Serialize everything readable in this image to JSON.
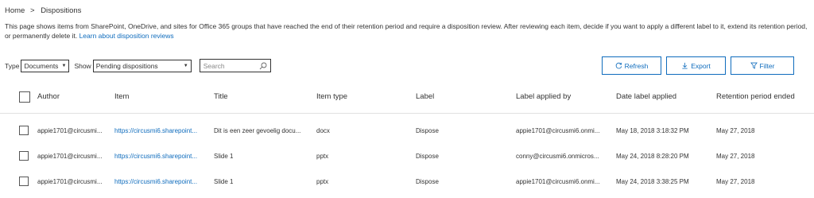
{
  "breadcrumb": {
    "home": "Home",
    "separator": ">",
    "current": "Dispositions"
  },
  "intro": {
    "text": "This page shows items from SharePoint, OneDrive, and sites for Office 365 groups that have reached the end of their retention period and require a disposition review. After reviewing each item, decide if you want to apply a different label to it, extend its retention period, or permanently delete it.",
    "link": "Learn about disposition reviews"
  },
  "filters": {
    "type_label": "Type",
    "type_value": "Documents",
    "show_label": "Show",
    "show_value": "Pending dispositions",
    "search_placeholder": "Search"
  },
  "actions": {
    "refresh": "Refresh",
    "export": "Export",
    "filter": "Filter"
  },
  "table": {
    "columns": {
      "author": "Author",
      "item": "Item",
      "title": "Title",
      "item_type": "Item type",
      "label": "Label",
      "label_applied_by": "Label applied by",
      "date_label_applied": "Date label applied",
      "retention_period_ended": "Retention period ended"
    },
    "rows": [
      {
        "author": "appie1701@circusmi...",
        "item": "https://circusmi6.sharepoint...",
        "title": "Dit is een zeer gevoelig docu...",
        "item_type": "docx",
        "label": "Dispose",
        "label_applied_by": "appie1701@circusmi6.onmi...",
        "date_label_applied": "May 18, 2018 3:18:32 PM",
        "retention_period_ended": "May 27, 2018"
      },
      {
        "author": "appie1701@circusmi...",
        "item": "https://circusmi6.sharepoint...",
        "title": "Slide 1",
        "item_type": "pptx",
        "label": "Dispose",
        "label_applied_by": "conny@circusmi6.onmicros...",
        "date_label_applied": "May 24, 2018 8:28:20 PM",
        "retention_period_ended": "May 27, 2018"
      },
      {
        "author": "appie1701@circusmi...",
        "item": "https://circusmi6.sharepoint...",
        "title": "Slide 1",
        "item_type": "pptx",
        "label": "Dispose",
        "label_applied_by": "appie1701@circusmi6.onmi...",
        "date_label_applied": "May 24, 2018 3:38:25 PM",
        "retention_period_ended": "May 27, 2018"
      }
    ]
  },
  "icons": {
    "refresh": "refresh-icon",
    "export": "download-icon",
    "filter": "funnel-icon",
    "search": "search-icon",
    "dropdown": "caret-down-icon"
  },
  "colors": {
    "accent": "#0f6cbd",
    "text": "#333333",
    "border": "#333333",
    "divider": "#e1e1e1"
  }
}
